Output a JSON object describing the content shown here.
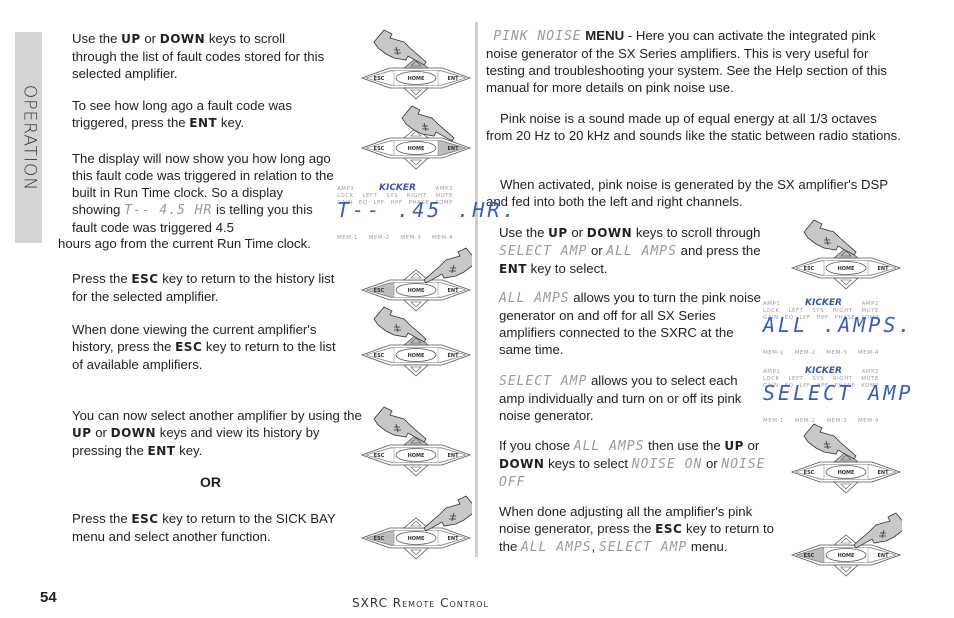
{
  "side_tab": {
    "label": "Operation"
  },
  "left": {
    "p1": {
      "a": "Use the ",
      "k1": "UP",
      "b": " or ",
      "k2": "DOWN",
      "c": " keys to scroll through the list of fault codes stored for this selected amplifier."
    },
    "p2": {
      "a": "To see how long ago a fault code was triggered, press the ",
      "k1": "ENT",
      "b": " key."
    },
    "p3": {
      "a": "The display will now show you how long ago this fault code was triggered in relation to the built in Run Time clock. So a display showing ",
      "lcd": "T-- 4.5 HR",
      "b": " is telling you this fault code was triggered 4.5",
      "c": "hours  ago from the current Run Time clock."
    },
    "p4": {
      "a": "Press the ",
      "k1": "ESC",
      "b": " key to return to the history list for the selected amplifier."
    },
    "p5": {
      "a": "When done viewing the current amplifier's history, press the ",
      "k1": "ESC",
      "b": " key to return to the list of available amplifiers."
    },
    "p6": {
      "a": "You can now select another amplifier by using the ",
      "k1": "UP",
      "b": " or ",
      "k2": "DOWN",
      "c": "  keys  and view its history by pressing the ",
      "k3": "ENT",
      "d": " key."
    },
    "or": "OR",
    "p7": {
      "a": "Press the ",
      "k1": "ESC",
      "b": " key to return to the SICK BAY menu and select another function."
    }
  },
  "right": {
    "p1": {
      "lcd": "PINK NOISE",
      "bold": "MENU",
      "a": " - Here you can activate the integrated pink noise generator of the SX Series amplifiers. This is very useful for testing and troubleshooting your system. See the Help section of this manual for more details on pink noise use."
    },
    "p2": "Pink noise is a sound made up of equal energy at all 1/3 octaves from 20 Hz to 20 kHz and sounds like the static between radio stations.",
    "p3": "When activated, pink noise is generated by the SX amplifier's DSP and fed into both the left and right channels.",
    "p4": {
      "a": "Use the ",
      "k1": "UP",
      "b": " or ",
      "k2": "DOWN",
      "c": " keys to scroll through ",
      "lcd1": "SELECT AMP",
      "d": " or ",
      "lcd2": "ALL AMPS",
      "e": " and press the ",
      "k3": "ENT",
      "f": " key to select."
    },
    "p5": {
      "lcd": "ALL AMPS",
      "a": " allows you to turn the pink noise generator on and off for all SX Series amplifiers connected to the SXRC at the same time."
    },
    "p6": {
      "lcd": "SELECT AMP",
      "a": " allows you to select each amp individually and turn on or off its pink noise generator."
    },
    "p7": {
      "a": "If you chose ",
      "lcd1": "ALL AMPS",
      "b": " then use the ",
      "k1": "UP",
      "c": " or ",
      "k2": "DOWN",
      "d": " keys to select ",
      "lcd2": "NOISE ON",
      "e": " or ",
      "lcd3": "NOISE OFF"
    },
    "p8": {
      "a": "When done adjusting all the amplifier's pink noise generator, press the ",
      "k1": "ESC",
      "b": " key to return to the ",
      "lcd1": "ALL AMPS",
      "c": ", ",
      "lcd2": "SELECT AMP",
      "d": " menu."
    }
  },
  "keypad": {
    "esc": "ESC",
    "home": "HOME",
    "ent": "ENT"
  },
  "display": {
    "brand": "KICKER",
    "row1": [
      "AMP1",
      "",
      "",
      "",
      "AMP2"
    ],
    "row2": [
      "LOCK",
      "LEFT",
      "SYS",
      "RIGHT",
      "MUTE"
    ],
    "row3": [
      "GAIN",
      "EQ",
      "LPF",
      "HPF",
      "PHASE",
      "KOMP"
    ],
    "row4": [
      "MEM-1",
      "MEM-2",
      "MEM-3",
      "MEM-4"
    ],
    "readouts": [
      "T--  .45 .HR.",
      "ALL .AMPS.",
      "SELECT AMP"
    ]
  },
  "footer": {
    "page_number": "54",
    "title": "SXRC Remote Control"
  }
}
